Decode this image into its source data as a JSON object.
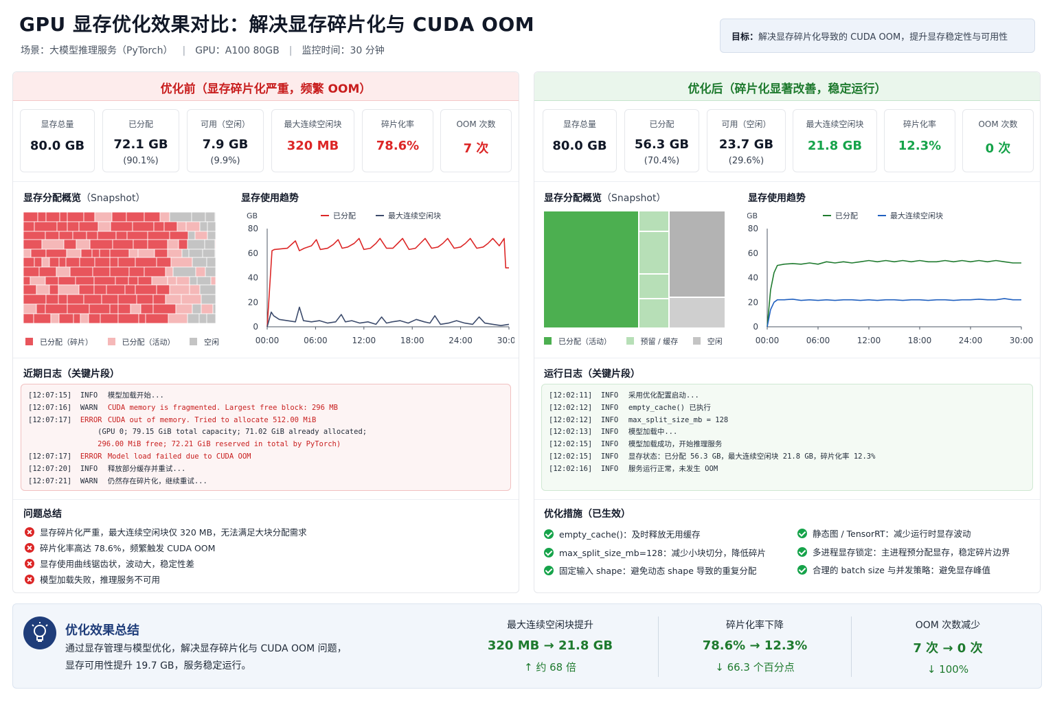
{
  "header": {
    "title": "GPU 显存优化效果对比：解决显存碎片化与 CUDA OOM",
    "scene": "场景：大模型推理服务（PyTorch）",
    "gpu": "GPU：A100 80GB",
    "monitor": "监控时间：30 分钟",
    "sep": "|",
    "goal_label": "目标：",
    "goal_text": "解决显存碎片化导致的 CUDA OOM，提升显存稳定性与可用性"
  },
  "before": {
    "title": "优化前（显存碎片化严重，频繁 OOM）",
    "stats": [
      {
        "label": "显存总量",
        "value": "80.0 GB",
        "sub": ""
      },
      {
        "label": "已分配",
        "value": "72.1 GB",
        "sub": "(90.1%)"
      },
      {
        "label": "可用（空闲）",
        "value": "7.9 GB",
        "sub": "(9.9%)"
      },
      {
        "label": "最大连续空闲块",
        "value": "320 MB",
        "sub": ""
      },
      {
        "label": "碎片化率",
        "value": "78.6%",
        "sub": ""
      },
      {
        "label": "OOM 次数",
        "value": "7 次",
        "sub": ""
      }
    ],
    "snapshot_title": "显存分配概览",
    "snapshot_suffix": "（Snapshot）",
    "legend": [
      "已分配（碎片）",
      "已分配（活动）",
      "空闲"
    ],
    "trend_title": "显存使用趋势",
    "log_title": "近期日志（关键片段）",
    "logs": [
      {
        "t": "[12:07:15]",
        "lvl": "INFO",
        "msg": "模型加载开始...",
        "kind": "info"
      },
      {
        "t": "[12:07:16]",
        "lvl": "WARN",
        "msg": "CUDA memory is fragmented. Largest free block: 296 MB",
        "kind": "warn"
      },
      {
        "t": "[12:07:17]",
        "lvl": "ERROR",
        "msg": "CUDA out of memory. Tried to allocate 512.00 MiB",
        "kind": "err"
      },
      {
        "t": "",
        "lvl": "",
        "msg": "(GPU 0; 79.15 GiB total capacity; 71.02 GiB already allocated;",
        "kind": "cont"
      },
      {
        "t": "",
        "lvl": "",
        "msg": "296.00 MiB free; 72.21 GiB reserved in total by PyTorch)",
        "kind": "cont2"
      },
      {
        "t": "[12:07:17]",
        "lvl": "ERROR",
        "msg": "Model load failed due to CUDA OOM",
        "kind": "err"
      },
      {
        "t": "[12:07:20]",
        "lvl": "INFO",
        "msg": "释放部分缓存并重试...",
        "kind": "info"
      },
      {
        "t": "[12:07:21]",
        "lvl": "WARN",
        "msg": "仍然存在碎片化，继续重试...",
        "kind": "info"
      }
    ],
    "issues_title": "问题总结",
    "issues": [
      "显存碎片化严重，最大连续空闲块仅 320 MB，无法满足大块分配需求",
      "碎片化率高达 78.6%，频繁触发 CUDA OOM",
      "显存使用曲线锯齿状，波动大，稳定性差",
      "模型加载失败，推理服务不可用"
    ]
  },
  "after": {
    "title": "优化后（碎片化显著改善，稳定运行）",
    "stats": [
      {
        "label": "显存总量",
        "value": "80.0 GB",
        "sub": ""
      },
      {
        "label": "已分配",
        "value": "56.3 GB",
        "sub": "(70.4%)"
      },
      {
        "label": "可用（空闲）",
        "value": "23.7 GB",
        "sub": "(29.6%)"
      },
      {
        "label": "最大连续空闲块",
        "value": "21.8 GB",
        "sub": ""
      },
      {
        "label": "碎片化率",
        "value": "12.3%",
        "sub": ""
      },
      {
        "label": "OOM 次数",
        "value": "0 次",
        "sub": ""
      }
    ],
    "snapshot_title": "显存分配概览",
    "snapshot_suffix": "（Snapshot）",
    "legend": [
      "已分配（活动）",
      "预留 / 缓存",
      "空闲"
    ],
    "trend_title": "显存使用趋势",
    "log_title": "运行日志（关键片段）",
    "logs": [
      {
        "t": "[12:02:11]",
        "lvl": "INFO",
        "msg": "采用优化配置启动...",
        "kind": "info"
      },
      {
        "t": "[12:02:12]",
        "lvl": "INFO",
        "msg": "empty_cache() 已执行",
        "kind": "info"
      },
      {
        "t": "[12:02:12]",
        "lvl": "INFO",
        "msg": "max_split_size_mb = 128",
        "kind": "info"
      },
      {
        "t": "[12:02:13]",
        "lvl": "INFO",
        "msg": "模型加载中...",
        "kind": "info"
      },
      {
        "t": "[12:02:15]",
        "lvl": "INFO",
        "msg": "模型加载成功，开始推理服务",
        "kind": "info"
      },
      {
        "t": "[12:02:15]",
        "lvl": "INFO",
        "msg": "显存状态：已分配 56.3 GB，最大连续空闲块 21.8 GB，碎片化率 12.3%",
        "kind": "info"
      },
      {
        "t": "[12:02:16]",
        "lvl": "INFO",
        "msg": "服务运行正常，未发生 OOM",
        "kind": "info"
      }
    ],
    "measures_title": "优化措施（已生效）",
    "measures": [
      "empty_cache()：及时释放无用缓存",
      "max_split_size_mb=128：减少小块切分，降低碎片",
      "固定输入 shape：避免动态 shape 导致的重复分配",
      "静态图 / TensorRT：减少运行时显存波动",
      "多进程显存锁定：主进程预分配显存，稳定碎片边界",
      "合理的 batch size 与并发策略：避免显存峰值"
    ]
  },
  "summary": {
    "title": "优化效果总结",
    "line1": "通过显存管理与模型优化，解决显存碎片化与 CUDA OOM 问题，",
    "line2": "显存可用性提升 19.7 GB，服务稳定运行。",
    "metrics": [
      {
        "label": "最大连续空闲块提升",
        "value": "320 MB → 21.8 GB",
        "sub": "↑ 约 68 倍"
      },
      {
        "label": "碎片化率下降",
        "value": "78.6% → 12.3%",
        "sub": "↓ 66.3 个百分点"
      },
      {
        "label": "OOM 次数减少",
        "value": "7 次 → 0 次",
        "sub": "↓ 100%"
      }
    ]
  },
  "colors": {
    "red": "#dc2626",
    "green": "#16a34a",
    "frag": "#e8555c",
    "active_light": "#f5b8b8",
    "free": "#c4c4c4",
    "active_green": "#4caf50",
    "reserved": "#b7dfb7",
    "navy": "#1f3d7a"
  },
  "chart_data": [
    {
      "type": "line",
      "title": "显存使用趋势",
      "ylabel": "GB",
      "ylim": [
        0,
        80
      ],
      "yticks": [
        0,
        20,
        40,
        60,
        80
      ],
      "xticks": [
        "00:00",
        "06:00",
        "12:00",
        "18:00",
        "24:00",
        "30:00"
      ],
      "xlim": [
        0,
        30
      ],
      "series": [
        {
          "name": "已分配",
          "color": "#dc2626",
          "x": [
            0,
            0.6,
            0.9,
            2.5,
            3.5,
            4.0,
            4.6,
            5.5,
            6.1,
            6.6,
            7.5,
            8.2,
            8.8,
            9.3,
            10.0,
            10.8,
            11.4,
            12.0,
            12.8,
            13.5,
            14.0,
            14.8,
            15.6,
            16.2,
            16.8,
            17.6,
            18.4,
            19.0,
            19.6,
            20.4,
            21.2,
            21.8,
            22.4,
            23.2,
            24.0,
            24.6,
            25.2,
            26.0,
            26.8,
            27.4,
            28.0,
            28.8,
            29.4,
            29.6,
            30.0
          ],
          "y": [
            0,
            62,
            63,
            64,
            70,
            62,
            64,
            66,
            71,
            63,
            64,
            67,
            71,
            64,
            65,
            68,
            72,
            63,
            64,
            68,
            72,
            64,
            64,
            68,
            72,
            63,
            64,
            68,
            72,
            64,
            65,
            68,
            72,
            64,
            65,
            68,
            72,
            64,
            65,
            68,
            72,
            66,
            72,
            48,
            48
          ]
        },
        {
          "name": "最大连续空闲块",
          "color": "#3b4a6b",
          "x": [
            0,
            0.5,
            0.8,
            1.5,
            2.5,
            3.5,
            4.0,
            4.5,
            5.5,
            6.5,
            7.5,
            8.5,
            9.2,
            9.7,
            10.5,
            11.5,
            12.5,
            13.5,
            14.2,
            14.8,
            15.5,
            16.5,
            17.5,
            18.5,
            19.5,
            20.2,
            20.8,
            21.5,
            22.5,
            23.5,
            24.5,
            25.5,
            26.3,
            27.0,
            28.0,
            29.0,
            30.0
          ],
          "y": [
            0,
            12,
            9,
            6,
            5,
            4,
            16,
            5,
            4,
            5,
            3,
            4,
            10,
            4,
            5,
            3,
            4,
            2,
            8,
            3,
            4,
            5,
            3,
            6,
            4,
            3,
            9,
            2,
            3,
            5,
            3,
            2,
            8,
            3,
            2,
            1,
            2
          ]
        }
      ]
    },
    {
      "type": "line",
      "title": "显存使用趋势",
      "ylabel": "GB",
      "ylim": [
        0,
        80
      ],
      "yticks": [
        0,
        20,
        40,
        60,
        80
      ],
      "xticks": [
        "00:00",
        "06:00",
        "12:00",
        "18:00",
        "24:00",
        "30:00"
      ],
      "xlim": [
        0,
        30
      ],
      "series": [
        {
          "name": "已分配",
          "color": "#1e7a2e",
          "x": [
            0,
            0.4,
            0.8,
            1.2,
            2.0,
            3.0,
            4.0,
            5.0,
            6.0,
            7.0,
            8.0,
            9.0,
            10.0,
            11.0,
            12.0,
            13.0,
            14.0,
            15.0,
            16.0,
            17.0,
            18.0,
            19.0,
            20.0,
            21.0,
            22.0,
            23.0,
            24.0,
            25.0,
            26.0,
            27.0,
            28.0,
            29.0,
            30.0
          ],
          "y": [
            0,
            30,
            44,
            50,
            51,
            51.5,
            51,
            52,
            51,
            53,
            52,
            53,
            52,
            53,
            54,
            53,
            54,
            53,
            54,
            53,
            54,
            53,
            53,
            54,
            53,
            54,
            53,
            54,
            53,
            54,
            53,
            52,
            52
          ]
        },
        {
          "name": "最大连续空闲块",
          "color": "#1f5fbf",
          "x": [
            0,
            0.4,
            0.8,
            1.2,
            2.0,
            3.0,
            4.0,
            5.0,
            6.0,
            7.0,
            8.0,
            9.0,
            10.0,
            11.0,
            12.0,
            13.0,
            14.0,
            15.0,
            16.0,
            17.0,
            18.0,
            19.0,
            20.0,
            21.0,
            22.0,
            23.0,
            24.0,
            25.0,
            26.0,
            27.0,
            28.0,
            29.0,
            30.0
          ],
          "y": [
            0,
            14,
            20,
            22,
            22,
            22.5,
            21.5,
            22,
            21.5,
            22,
            21.5,
            22,
            22,
            21.5,
            22,
            21.5,
            22,
            22,
            21.5,
            22,
            22,
            21.5,
            22,
            22,
            21.5,
            22,
            22,
            22.5,
            22,
            22,
            23,
            22,
            22
          ]
        }
      ]
    }
  ]
}
